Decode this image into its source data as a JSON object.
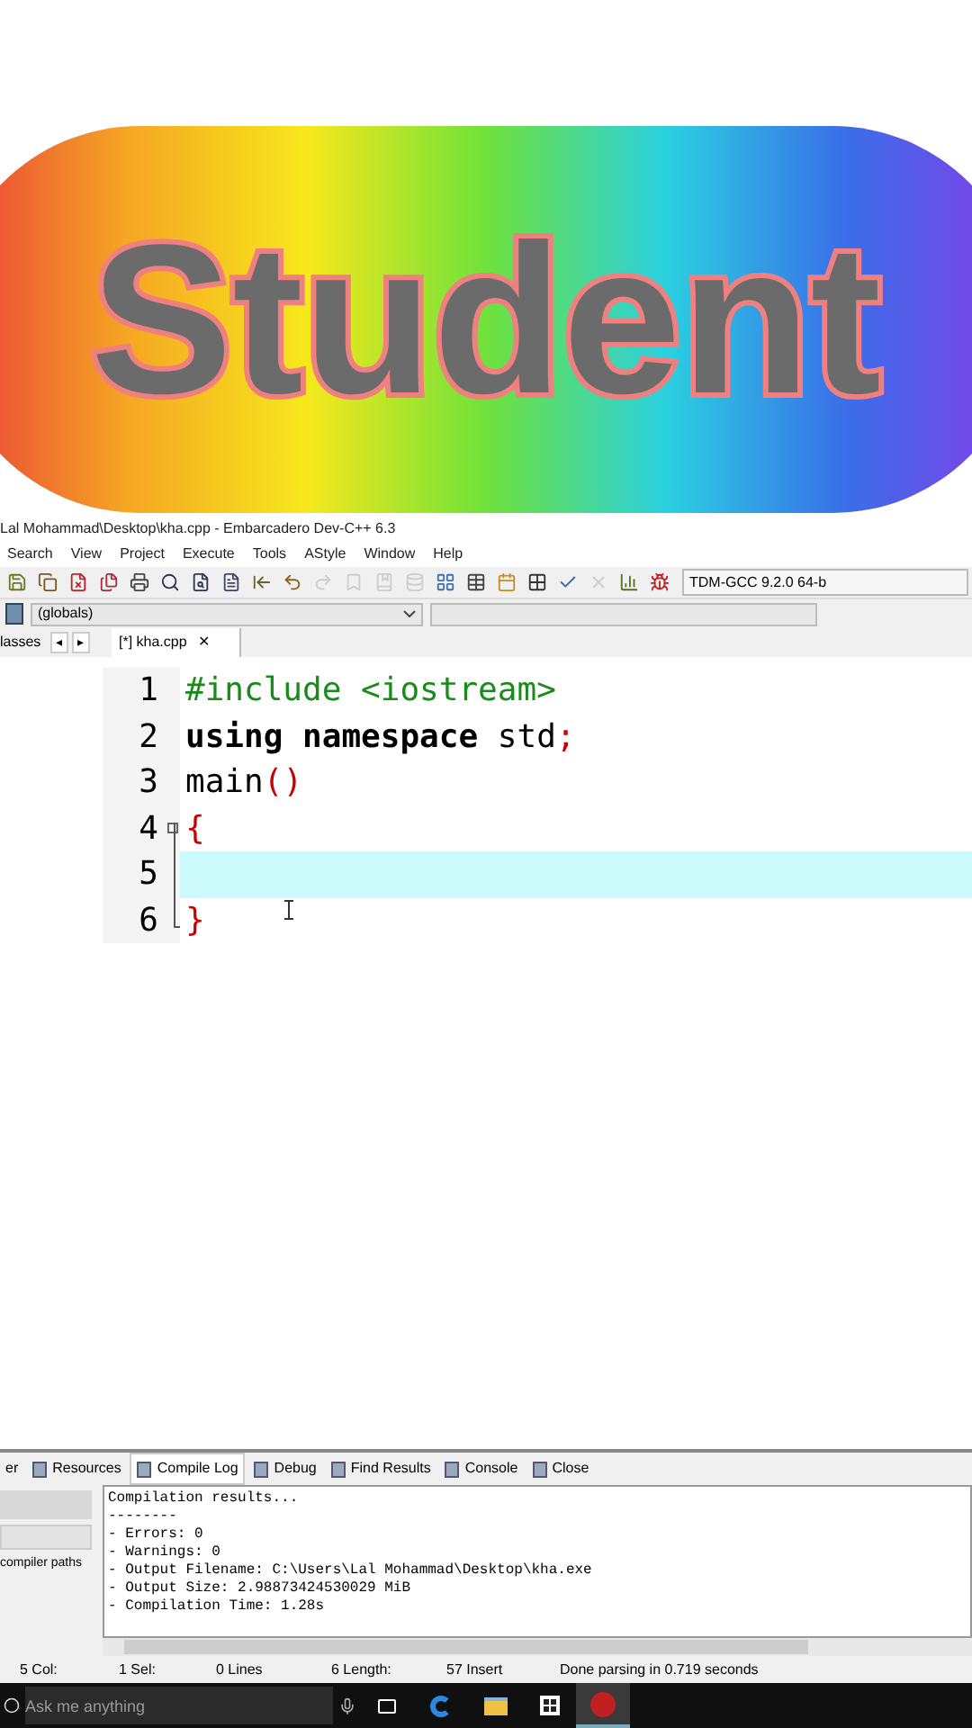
{
  "banner": {
    "title": "Student"
  },
  "window": {
    "title": "Lal Mohammad\\Desktop\\kha.cpp - Embarcadero Dev-C++ 6.3"
  },
  "menu": [
    "Search",
    "View",
    "Project",
    "Execute",
    "Tools",
    "AStyle",
    "Window",
    "Help"
  ],
  "toolbar": [
    {
      "disabled": false
    },
    {
      "disabled": false
    },
    {
      "disabled": false
    },
    {
      "disabled": false
    },
    {
      "disabled": false
    },
    {
      "disabled": false
    },
    {
      "disabled": false
    },
    {
      "disabled": false
    },
    {
      "disabled": false
    },
    {
      "disabled": false
    },
    {
      "disabled": true
    },
    {
      "disabled": true
    },
    {
      "disabled": true
    },
    {
      "disabled": true
    },
    {
      "disabled": false
    },
    {
      "disabled": false
    },
    {
      "disabled": false
    },
    {
      "disabled": false
    },
    {
      "disabled": false
    },
    {
      "disabled": true
    },
    {
      "disabled": false
    },
    {
      "disabled": false
    }
  ],
  "compiler_select": {
    "value": "TDM-GCC 9.2.0 64-b"
  },
  "scope_select": {
    "value": "(globals)"
  },
  "left_tabs": [
    "lasses",
    "◂",
    "▸"
  ],
  "file_tabs": [
    {
      "label": "[*] kha.cpp",
      "close": "✕",
      "selected": true
    }
  ],
  "editor": {
    "lines": [
      {
        "number": "1",
        "tokens": [
          {
            "kind": "preprocessor",
            "text": "#include <iostream>"
          }
        ]
      },
      {
        "number": "2",
        "tokens": [
          {
            "kind": "keyword",
            "text": "using namespace"
          },
          {
            "kind": "plain",
            "text": " std"
          },
          {
            "kind": "symbol",
            "text": ";"
          }
        ]
      },
      {
        "number": "3",
        "tokens": [
          {
            "kind": "plain",
            "text": "main"
          },
          {
            "kind": "symbol",
            "text": "()"
          }
        ]
      },
      {
        "number": "4",
        "fold": true,
        "tokens": [
          {
            "kind": "symbol",
            "text": "{"
          }
        ]
      },
      {
        "number": "5",
        "current": true
      },
      {
        "number": "6",
        "tokens": [
          {
            "kind": "symbol",
            "text": "}"
          }
        ]
      }
    ]
  },
  "left_panel": {
    "label": "compiler paths"
  },
  "bottom_tabs": [
    {
      "label": "er",
      "selected": false
    },
    {
      "label": "Resources",
      "selected": false
    },
    {
      "label": "Compile Log",
      "selected": true
    },
    {
      "label": "Debug",
      "selected": false
    },
    {
      "label": "Find Results",
      "selected": false
    },
    {
      "label": "Console",
      "selected": false
    },
    {
      "label": "Close",
      "selected": false
    }
  ],
  "compile_log": [
    "Compilation results...",
    "--------",
    "- Errors: 0",
    "- Warnings: 0",
    "- Output Filename: C:\\Users\\Lal Mohammad\\Desktop\\kha.exe",
    "- Output Size: 2.98873424530029 MiB",
    "- Compilation Time: 1.28s"
  ],
  "status_bar": [
    "5 Col:",
    "1 Sel:",
    "0 Lines",
    "6 Length:",
    "57 Insert",
    "Done parsing in 0.719 seconds"
  ],
  "taskbar": {
    "search_placeholder": "Ask me anything",
    "apps": [
      {
        "kind": "taskview",
        "active": false
      },
      {
        "kind": "edge",
        "active": false
      },
      {
        "kind": "explorer",
        "active": false
      },
      {
        "kind": "store",
        "active": false
      },
      {
        "kind": "devcpp",
        "active": true
      }
    ]
  }
}
